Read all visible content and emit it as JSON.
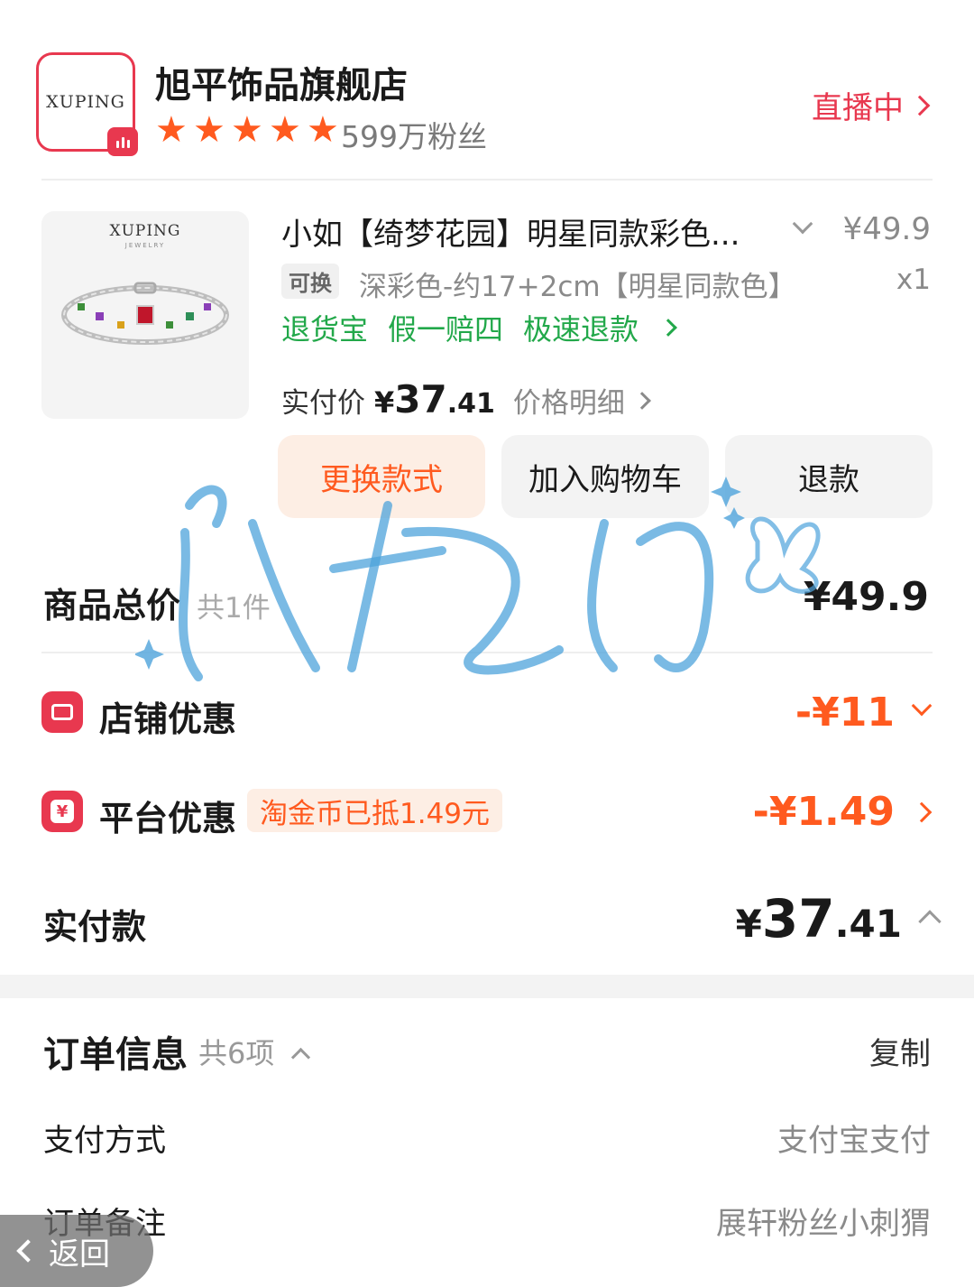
{
  "store": {
    "logo_text": "XUPING",
    "name": "旭平饰品旗舰店",
    "rating_stars": 5,
    "fans": "599万粉丝",
    "live_label": "直播中"
  },
  "product": {
    "image_brand": "XUPING",
    "image_brand_sub": "JEWELRY",
    "title": "小如【绮梦花园】明星同款彩色...",
    "price": "¥49.9",
    "swap_tag": "可换",
    "sku": "深彩色-约17+2cm【明星同款色】",
    "quantity": "x1",
    "services": [
      "退货宝",
      "假一赔四",
      "极速退款"
    ],
    "paid_label": "实付价",
    "paid_symbol": "¥",
    "paid_int": "37",
    "paid_dec": ".41",
    "price_detail": "价格明细",
    "buttons": {
      "swap": "更换款式",
      "cart": "加入购物车",
      "refund": "退款"
    }
  },
  "summary": {
    "total_label": "商品总价",
    "total_count": "共1件",
    "total_price": "¥49.9",
    "store_discount_label": "店铺优惠",
    "store_discount_value": "-¥11",
    "platform_discount_label": "平台优惠",
    "platform_coin_tag": "淘金币已抵1.49元",
    "platform_discount_value": "-¥1.49",
    "paid_label": "实付款",
    "paid_symbol": "¥",
    "paid_int": "37",
    "paid_dec": ".41"
  },
  "order_info": {
    "title": "订单信息",
    "count": "共6项",
    "copy": "复制",
    "rows": [
      {
        "label": "支付方式",
        "value": "支付宝支付"
      },
      {
        "label": "订单备注",
        "value": "展轩粉丝小刺猬"
      }
    ]
  },
  "back_label": "返回",
  "watermark_text": "小橘涧",
  "colors": {
    "brand_red": "#e8384f",
    "orange": "#ff5a1f",
    "green": "#22a84a",
    "gray_text": "#8a8a8a",
    "watermark_blue": "#4da3db"
  }
}
